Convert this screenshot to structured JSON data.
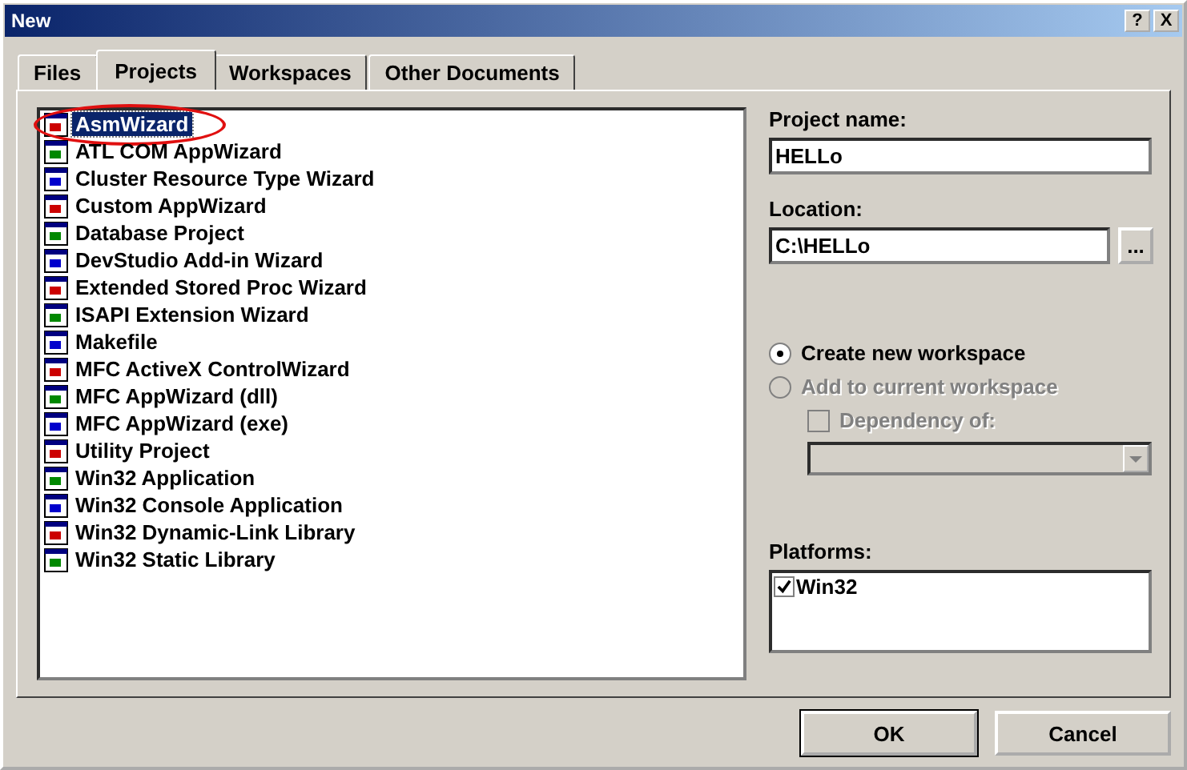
{
  "window": {
    "title": "New",
    "help_button": "?",
    "close_button": "X"
  },
  "tabs": [
    {
      "label": "Files",
      "selected": false
    },
    {
      "label": "Projects",
      "selected": true
    },
    {
      "label": "Workspaces",
      "selected": false
    },
    {
      "label": "Other Documents",
      "selected": false
    }
  ],
  "project_types": [
    {
      "label": "AsmWizard",
      "selected": true,
      "circled": true
    },
    {
      "label": "ATL COM AppWizard",
      "selected": false,
      "circled": false
    },
    {
      "label": "Cluster Resource Type Wizard",
      "selected": false,
      "circled": false
    },
    {
      "label": "Custom AppWizard",
      "selected": false,
      "circled": false
    },
    {
      "label": "Database Project",
      "selected": false,
      "circled": false
    },
    {
      "label": "DevStudio Add-in Wizard",
      "selected": false,
      "circled": false
    },
    {
      "label": "Extended Stored Proc Wizard",
      "selected": false,
      "circled": false
    },
    {
      "label": "ISAPI Extension Wizard",
      "selected": false,
      "circled": false
    },
    {
      "label": "Makefile",
      "selected": false,
      "circled": false
    },
    {
      "label": "MFC ActiveX ControlWizard",
      "selected": false,
      "circled": false
    },
    {
      "label": "MFC AppWizard (dll)",
      "selected": false,
      "circled": false
    },
    {
      "label": "MFC AppWizard (exe)",
      "selected": false,
      "circled": false
    },
    {
      "label": "Utility Project",
      "selected": false,
      "circled": false
    },
    {
      "label": "Win32 Application",
      "selected": false,
      "circled": false
    },
    {
      "label": "Win32 Console Application",
      "selected": false,
      "circled": false
    },
    {
      "label": "Win32 Dynamic-Link Library",
      "selected": false,
      "circled": false
    },
    {
      "label": "Win32 Static Library",
      "selected": false,
      "circled": false
    }
  ],
  "project_name": {
    "label": "Project name:",
    "value": "HELLo"
  },
  "location": {
    "label": "Location:",
    "value": "C:\\HELLo",
    "browse_button": "..."
  },
  "workspace_options": [
    {
      "label": "Create new workspace",
      "selected": true,
      "disabled": false
    },
    {
      "label": "Add to current workspace",
      "selected": false,
      "disabled": true
    }
  ],
  "dependency": {
    "label": "Dependency of:",
    "checked": false,
    "disabled": true
  },
  "platforms": {
    "label": "Platforms:",
    "items": [
      {
        "label": "Win32",
        "checked": true
      }
    ]
  },
  "buttons": [
    "OK",
    "Cancel"
  ]
}
